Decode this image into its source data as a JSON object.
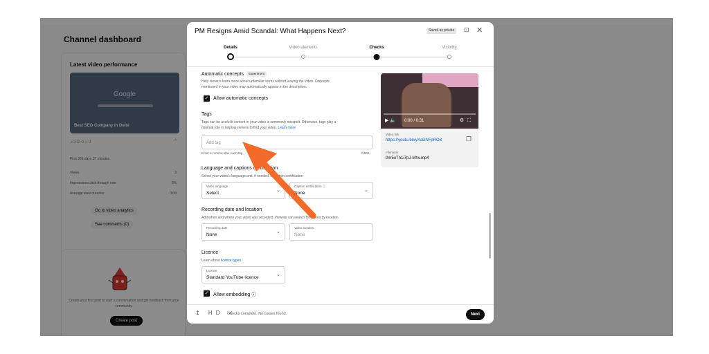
{
  "background": {
    "dashboard_title": "Channel dashboard",
    "latest_video": {
      "title": "Latest video performance",
      "thumbnail_brand": "Google",
      "thumbnail_caption": "Best SEO Company in Delhi",
      "stats": "⩘ 3   ⎚ 0   ⌂ 0",
      "first_days": "First 359 days 37 minutes",
      "rows": [
        {
          "label": "Views",
          "value": "3"
        },
        {
          "label": "Impressions click-through rate",
          "value": "0%"
        },
        {
          "label": "Average view duration",
          "value": "0:08"
        }
      ],
      "analytics_button": "Go to video analytics",
      "comments_button": "See comments (0)"
    },
    "community": {
      "text": "Create your first post to start a conversation and get feedback from your community.",
      "button": "Create post"
    }
  },
  "dialog": {
    "title": "PM Resigns Amid Scandal: What Happens Next?",
    "saved_badge": "Saved as private",
    "steps": [
      {
        "label": "Details",
        "state": "current"
      },
      {
        "label": "Video elements",
        "state": "pending"
      },
      {
        "label": "Checks",
        "state": "done"
      },
      {
        "label": "Visibility",
        "state": "pending"
      }
    ],
    "auto_concepts": {
      "heading": "Automatic concepts",
      "badge": "Experiment",
      "desc1": "Help viewers learn more about unfamiliar terms without leaving the video. Concepts",
      "desc2": "mentioned in your video may automatically appear in the description.",
      "checkbox": "Allow automatic concepts"
    },
    "tags": {
      "heading": "Tags",
      "desc1": "Tags can be useful if content in your video is commonly misspelt. Otherwise, tags play a",
      "desc2": "minimal role in helping viewers to find your video.",
      "learn_more": "Learn more",
      "placeholder": "Add tag",
      "hint": "Enter a comma after each tag",
      "counter": "0/500"
    },
    "language": {
      "heading": "Language and captions certification",
      "desc": "Select your video's language and, if needed, a caption certification",
      "video_language_label": "Video language",
      "video_language_value": "Select",
      "caption_label": "Caption certification ⓘ",
      "caption_value": "None"
    },
    "recording": {
      "heading": "Recording date and location",
      "desc": "Add when and where your video was recorded. Viewers can search for videos by location.",
      "date_label": "Recording date",
      "date_value": "None",
      "location_label": "Video location",
      "location_placeholder": "None"
    },
    "licence": {
      "heading": "Licence",
      "desc": "Learn about",
      "link": "licence types.",
      "field_label": "Licence",
      "field_value": "Standard YouTube licence",
      "embedding": "Allow embedding ⓘ"
    },
    "preview": {
      "time": "0:00 / 0:31",
      "link_label": "Video link",
      "link": "https://youtu.be/yXaDNFpRO8",
      "filename_label": "Filename",
      "filename": "0m5oTn1i7pJ-Mhv.mp4"
    },
    "footer": {
      "status": "Checks complete. No issues found.",
      "next": "Next"
    }
  },
  "colors": {
    "arrow": "#f26b2a",
    "link": "#065fd4",
    "overlay": "rgba(0,0,0,0.45)"
  }
}
